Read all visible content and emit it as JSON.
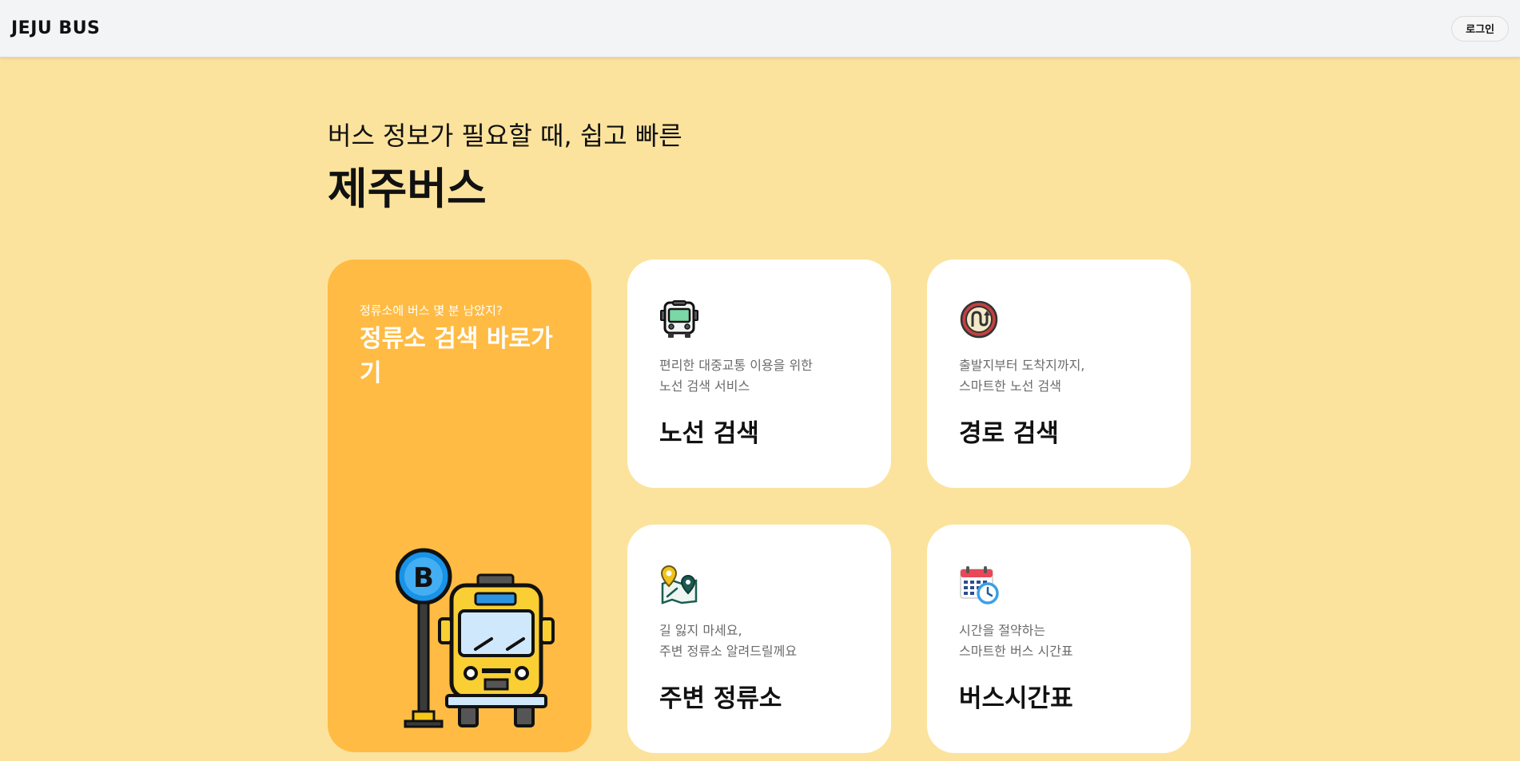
{
  "header": {
    "logo": "JEJU BUS",
    "login_label": "로그인"
  },
  "hero": {
    "subtitle": "버스 정보가 필요할 때, 쉽고 빠른",
    "title": "제주버스"
  },
  "stop_card": {
    "subtitle": "정류소에 버스 몇 분 남았지?",
    "title": "정류소 검색 바로가기"
  },
  "cards": [
    {
      "icon": "bus-front-icon",
      "desc": "편리한 대중교통 이용을 위한\n노선 검색 서비스",
      "title": "노선 검색"
    },
    {
      "icon": "route-sign-icon",
      "desc": "출발지부터 도착지까지,\n스마트한 노선 검색",
      "title": "경로 검색"
    },
    {
      "icon": "map-pin-icon",
      "desc": "길 잃지 마세요,\n주변 정류소 알려드릴께요",
      "title": "주변 정류소"
    },
    {
      "icon": "calendar-clock-icon",
      "desc": "시간을 절약하는\n스마트한 버스 시간표",
      "title": "버스시간표"
    }
  ],
  "colors": {
    "page_bg": "#fce39d",
    "stop_card_bg": "#ffbb43",
    "card_bg": "#ffffff",
    "header_bg": "#f3f4f6"
  }
}
